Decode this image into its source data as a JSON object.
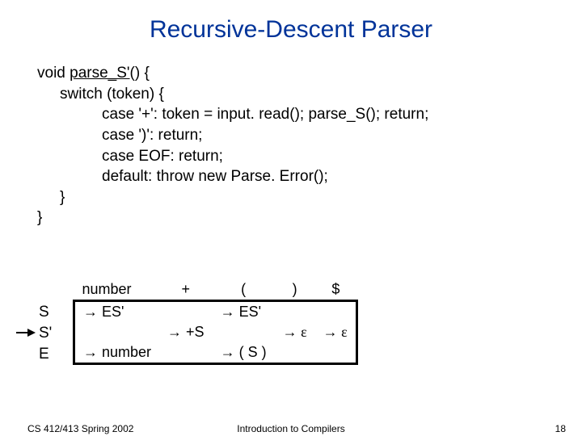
{
  "title": "Recursive-Descent Parser",
  "code": {
    "l0a": "void ",
    "l0b": "parse_S'",
    "l0c": "() {",
    "l1": "switch (token) {",
    "l2": "case '+': token = input. read(); parse_S(); return;",
    "l3": "case ')': return;",
    "l4": "case EOF: return;",
    "l5": "default: throw new Parse. Error();",
    "l6": "}",
    "l7": "}"
  },
  "rowlabels": {
    "r0": "S",
    "r1": "S'",
    "r2": "E"
  },
  "table": {
    "headers": [
      "number",
      "+",
      "(",
      ")",
      "$"
    ],
    "rows": [
      [
        "→ ES'",
        "",
        "→ ES'",
        "",
        ""
      ],
      [
        "",
        "→ +S",
        "",
        "→ ε",
        "→ ε"
      ],
      [
        "→ number",
        "",
        "→ ( S )",
        "",
        ""
      ]
    ]
  },
  "footer": {
    "left": "CS 412/413   Spring 2002",
    "center": "Introduction to Compilers",
    "right": "18"
  }
}
